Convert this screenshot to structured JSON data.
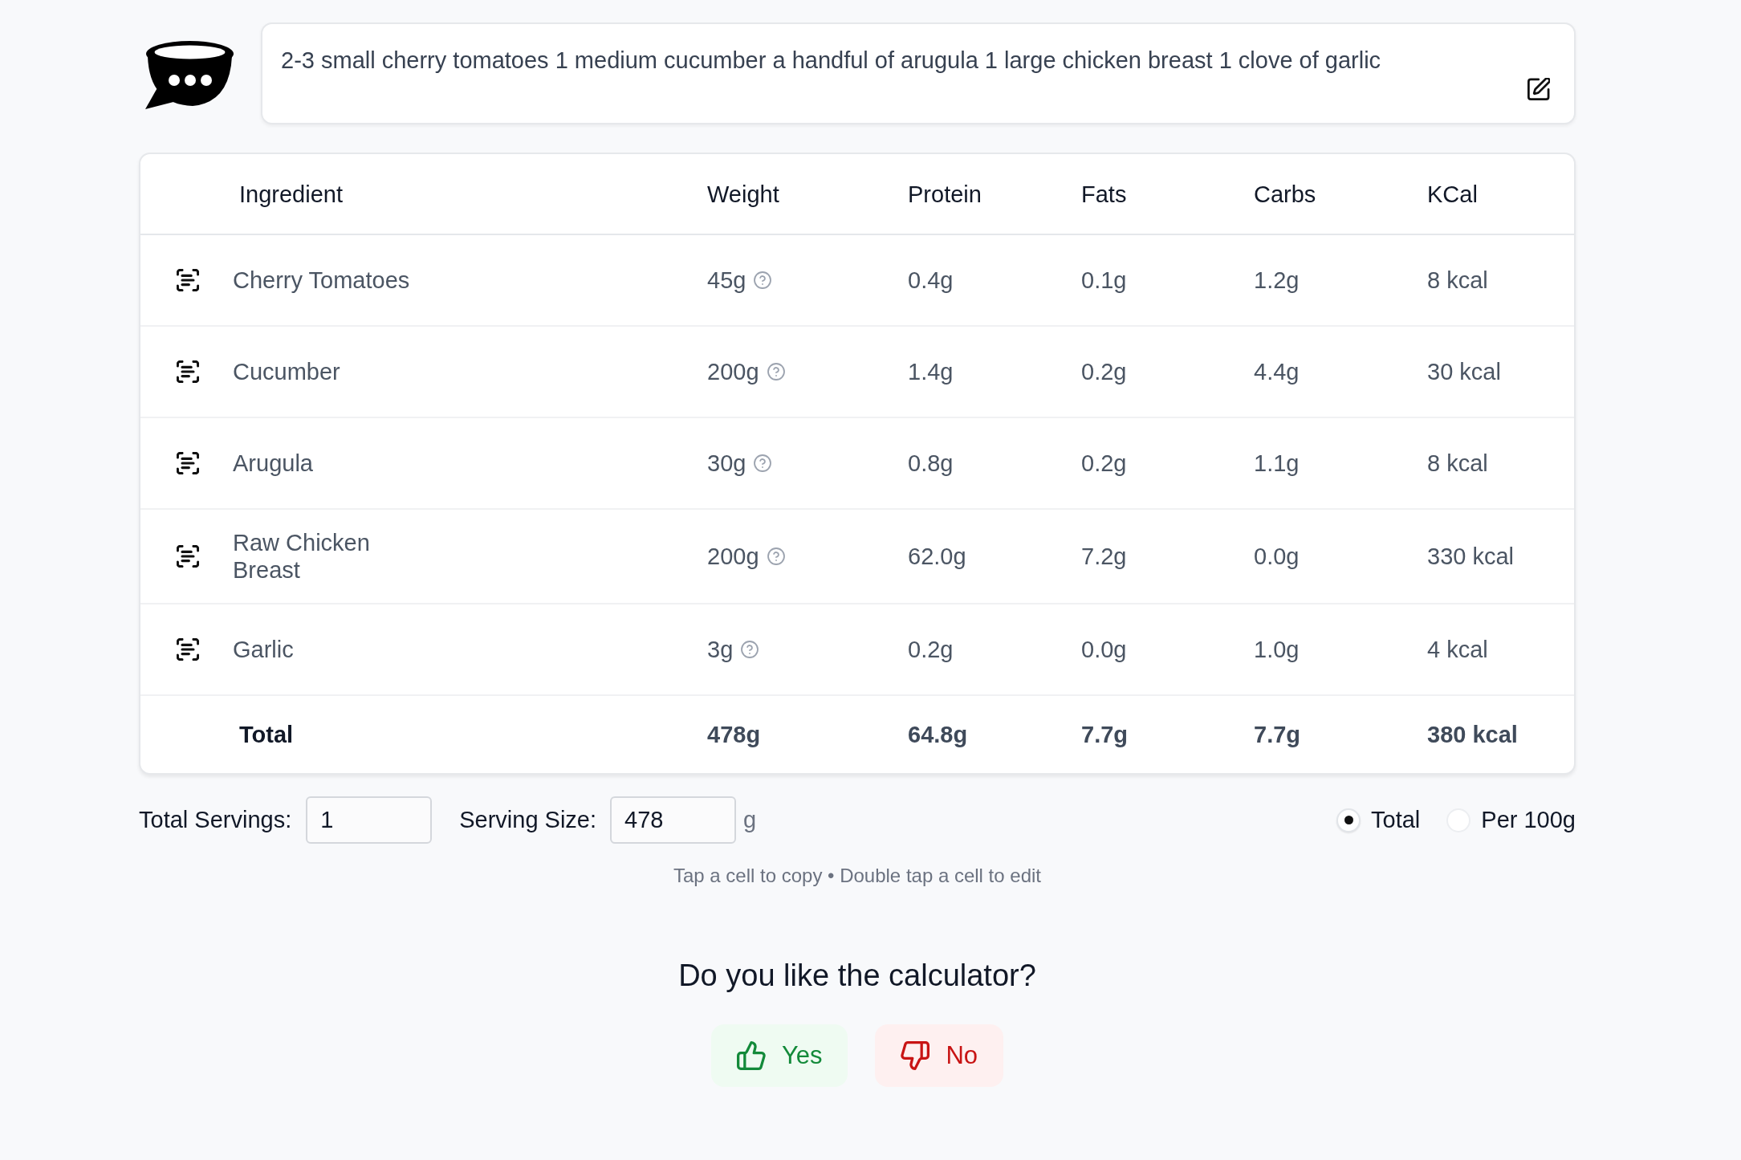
{
  "ingredients_input": {
    "value": "2-3 small cherry tomatoes 1 medium cucumber a handful of arugula 1 large chicken breast 1 clove of garlic"
  },
  "table": {
    "columns": [
      "Ingredient",
      "Weight",
      "Protein",
      "Fats",
      "Carbs",
      "KCal"
    ],
    "rows": [
      {
        "ingredient": "Cherry Tomatoes",
        "weight": "45g",
        "protein": "0.4g",
        "fats": "0.1g",
        "carbs": "1.2g",
        "kcal": "8 kcal"
      },
      {
        "ingredient": "Cucumber",
        "weight": "200g",
        "protein": "1.4g",
        "fats": "0.2g",
        "carbs": "4.4g",
        "kcal": "30 kcal"
      },
      {
        "ingredient": "Arugula",
        "weight": "30g",
        "protein": "0.8g",
        "fats": "0.2g",
        "carbs": "1.1g",
        "kcal": "8 kcal"
      },
      {
        "ingredient": "Raw Chicken Breast",
        "weight": "200g",
        "protein": "62.0g",
        "fats": "7.2g",
        "carbs": "0.0g",
        "kcal": "330 kcal"
      },
      {
        "ingredient": "Garlic",
        "weight": "3g",
        "protein": "0.2g",
        "fats": "0.0g",
        "carbs": "1.0g",
        "kcal": "4 kcal"
      }
    ],
    "total": {
      "label": "Total",
      "weight": "478g",
      "protein": "64.8g",
      "fats": "7.7g",
      "carbs": "7.7g",
      "kcal": "380 kcal"
    }
  },
  "servings": {
    "total_servings": {
      "label": "Total Servings:",
      "value": "1"
    },
    "serving_size": {
      "label": "Serving Size:",
      "value": "478",
      "unit": "g"
    }
  },
  "display_mode": [
    {
      "label": "Total",
      "selected": true
    },
    {
      "label": "Per 100g",
      "selected": false
    }
  ],
  "hint": "Tap a cell to copy • Double tap a cell to edit",
  "feedback": {
    "question": "Do you like the calculator?",
    "buttons": [
      {
        "label": "Yes",
        "kind": "yes"
      },
      {
        "label": "No",
        "kind": "no"
      }
    ]
  }
}
